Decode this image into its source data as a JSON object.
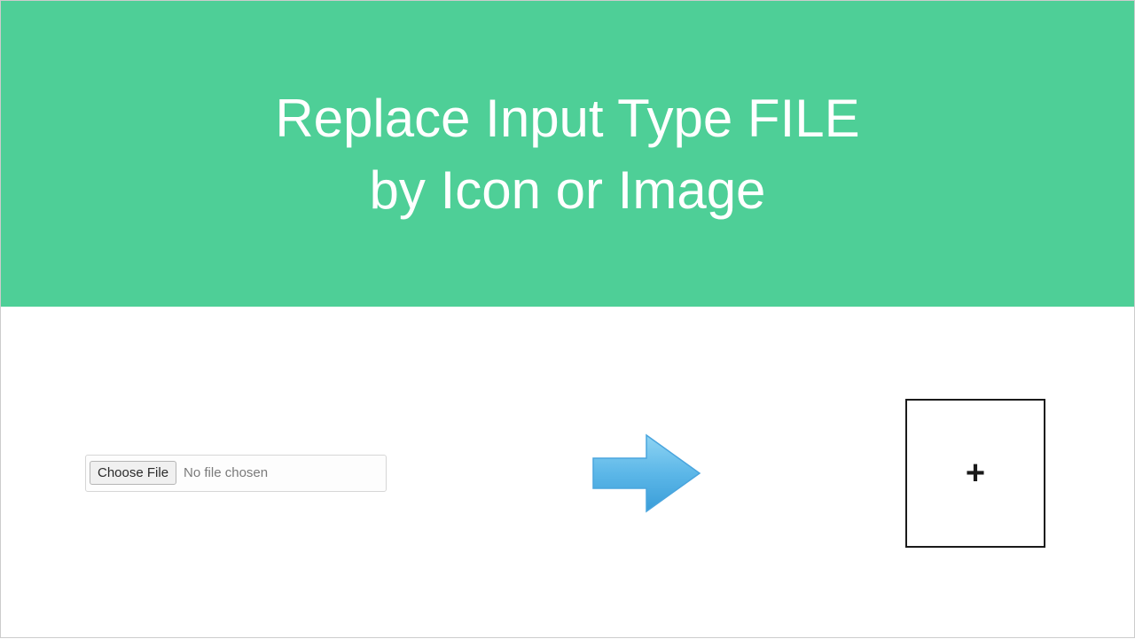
{
  "header": {
    "title_line1": "Replace Input Type FILE",
    "title_line2": "by Icon or Image"
  },
  "fileInput": {
    "button_label": "Choose File",
    "status_text": "No file chosen"
  },
  "plusBox": {
    "symbol": "+"
  },
  "colors": {
    "header_bg": "#4ecf97",
    "arrow_fill": "#5cb7e8"
  }
}
